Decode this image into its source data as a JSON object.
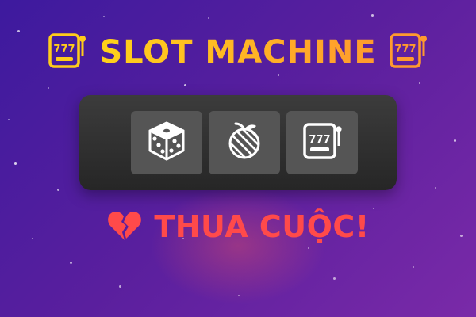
{
  "title": {
    "text": "SLOT MACHINE",
    "left_icon": "slot-machine-icon",
    "right_icon": "slot-machine-icon",
    "color_start": "#ffd21a",
    "color_end": "#ff9a2e"
  },
  "reels": [
    {
      "symbol": "dice-icon"
    },
    {
      "symbol": "peach-icon"
    },
    {
      "symbol": "slot-machine-icon"
    }
  ],
  "result": {
    "text": "THUA CUỘC!",
    "icon": "broken-heart-icon",
    "color": "#ff4a4a"
  }
}
